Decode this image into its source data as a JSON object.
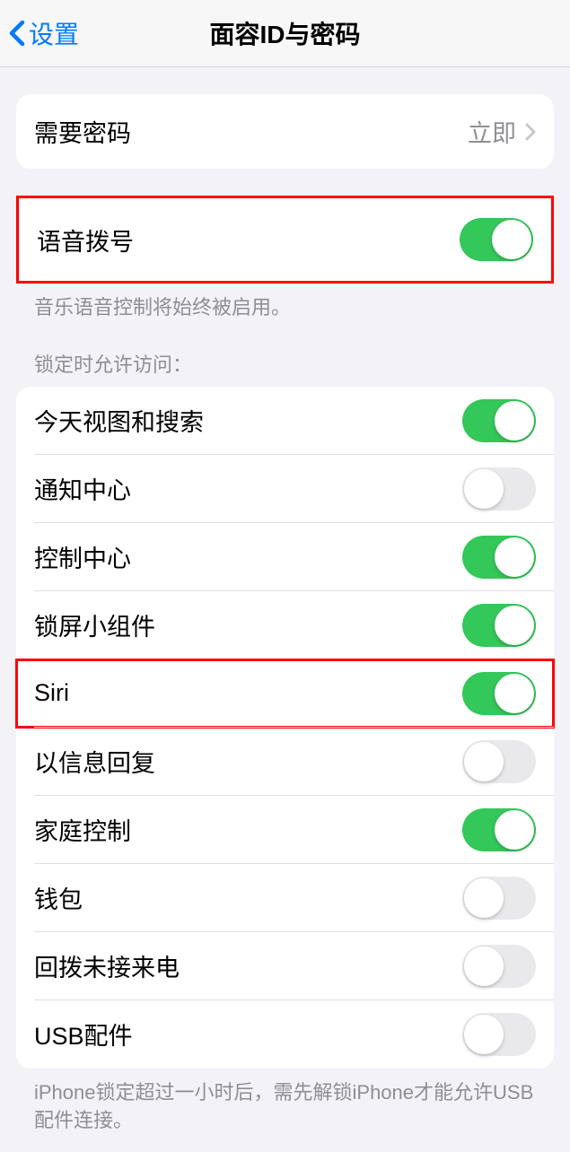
{
  "nav": {
    "back_label": "设置",
    "title": "面容ID与密码"
  },
  "require_passcode": {
    "label": "需要密码",
    "value": "立即"
  },
  "voice_dial": {
    "label": "语音拨号",
    "enabled": true,
    "footer": "音乐语音控制将始终被启用。"
  },
  "lock_access": {
    "header": "锁定时允许访问：",
    "items": [
      {
        "label": "今天视图和搜索",
        "enabled": true
      },
      {
        "label": "通知中心",
        "enabled": false
      },
      {
        "label": "控制中心",
        "enabled": true
      },
      {
        "label": "锁屏小组件",
        "enabled": true
      },
      {
        "label": "Siri",
        "enabled": true
      },
      {
        "label": "以信息回复",
        "enabled": false
      },
      {
        "label": "家庭控制",
        "enabled": true
      },
      {
        "label": "钱包",
        "enabled": false
      },
      {
        "label": "回拨未接来电",
        "enabled": false
      },
      {
        "label": "USB配件",
        "enabled": false
      }
    ],
    "footer": "iPhone锁定超过一小时后，需先解锁iPhone才能允许USB配件连接。"
  }
}
